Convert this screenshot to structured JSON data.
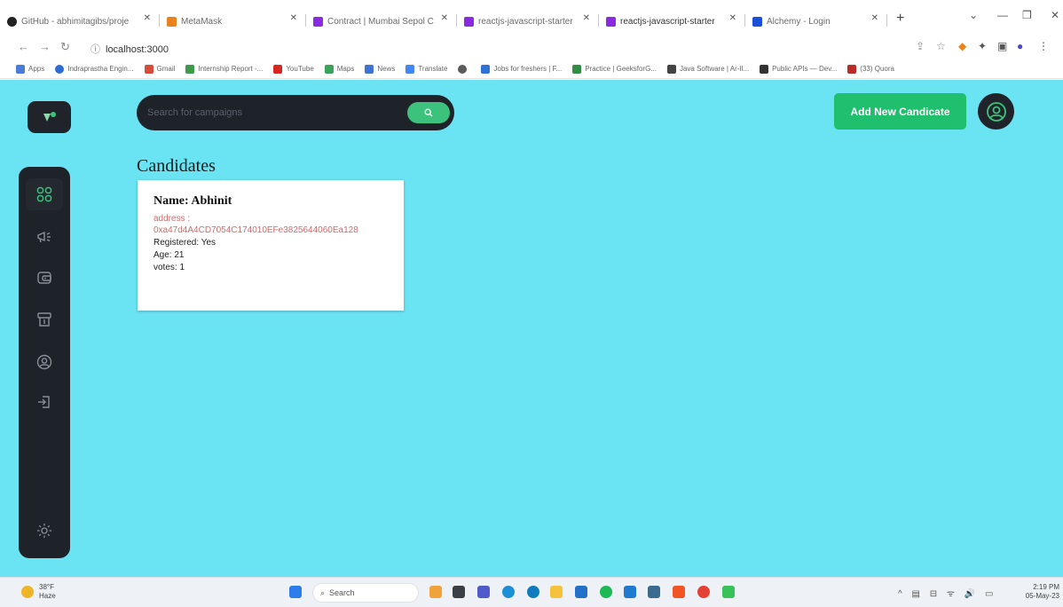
{
  "browser": {
    "tabs": [
      {
        "title": "GitHub - abhimitagibs/proje",
        "color": "#222222",
        "active": false
      },
      {
        "title": "MetaMask",
        "color": "#e8831d",
        "active": false
      },
      {
        "title": "Contract | Mumbai Sepol C",
        "color": "#8a2be2",
        "active": false
      },
      {
        "title": "reactjs-javascript-starter",
        "color": "#8a2be2",
        "active": false
      },
      {
        "title": "reactjs-javascript-starter",
        "color": "#8a2be2",
        "active": true
      },
      {
        "title": "Alchemy - Login",
        "color": "#1a4fd8",
        "active": false
      }
    ],
    "new_tab_label": "+",
    "url": "localhost:3000",
    "bookmarks": [
      {
        "label": "Apps",
        "color": "#4a7bd8"
      },
      {
        "label": "Indraprastha Engin...",
        "color": "#2f6bd4"
      },
      {
        "label": "Gmail",
        "color": "#d64c3b"
      },
      {
        "label": "Internship Report -...",
        "color": "#3d9a4a"
      },
      {
        "label": "YouTube",
        "color": "#d7261f"
      },
      {
        "label": "Maps",
        "color": "#3aa35a"
      },
      {
        "label": "News",
        "color": "#3f73d1"
      },
      {
        "label": "Translate",
        "color": "#4285f4"
      },
      {
        "label": "",
        "color": "#5b5b5b"
      },
      {
        "label": "Jobs for freshers | F...",
        "color": "#2f72d6"
      },
      {
        "label": "Practice | GeeksforG...",
        "color": "#2f8d46"
      },
      {
        "label": "Java Software | Ar-Il...",
        "color": "#444444"
      },
      {
        "label": "Public APIs — Dev...",
        "color": "#333333"
      },
      {
        "label": "(33) Quora",
        "color": "#b92b27"
      }
    ]
  },
  "app": {
    "search": {
      "placeholder": "Search for campaigns"
    },
    "add_button_label": "Add New Candicate",
    "page_title": "Candidates",
    "candidate": {
      "name": "Name: Abhinit",
      "address_label": "address :",
      "address": "0xa47d4A4CD7054C174010EFe3825644060Ea128",
      "registered": "Registered: Yes",
      "age": "Age: 21",
      "votes": "votes: 1"
    },
    "sidebar": [
      {
        "icon": "dashboard-icon",
        "active": true
      },
      {
        "icon": "campaign-icon",
        "active": false
      },
      {
        "icon": "payment-icon",
        "active": false
      },
      {
        "icon": "withdraw-icon",
        "active": false
      },
      {
        "icon": "profile-icon",
        "active": false
      },
      {
        "icon": "logout-icon",
        "active": false
      },
      {
        "icon": "theme-sun-icon",
        "active": false
      }
    ],
    "colors": {
      "background": "#6ae3f3",
      "accent": "#20bf6e",
      "dark": "#1e2229"
    }
  },
  "taskbar": {
    "weather_temp": "38°F",
    "weather_desc": "Haze",
    "search_label": "Search",
    "time": "2:19 PM",
    "date": "05-May-23"
  }
}
